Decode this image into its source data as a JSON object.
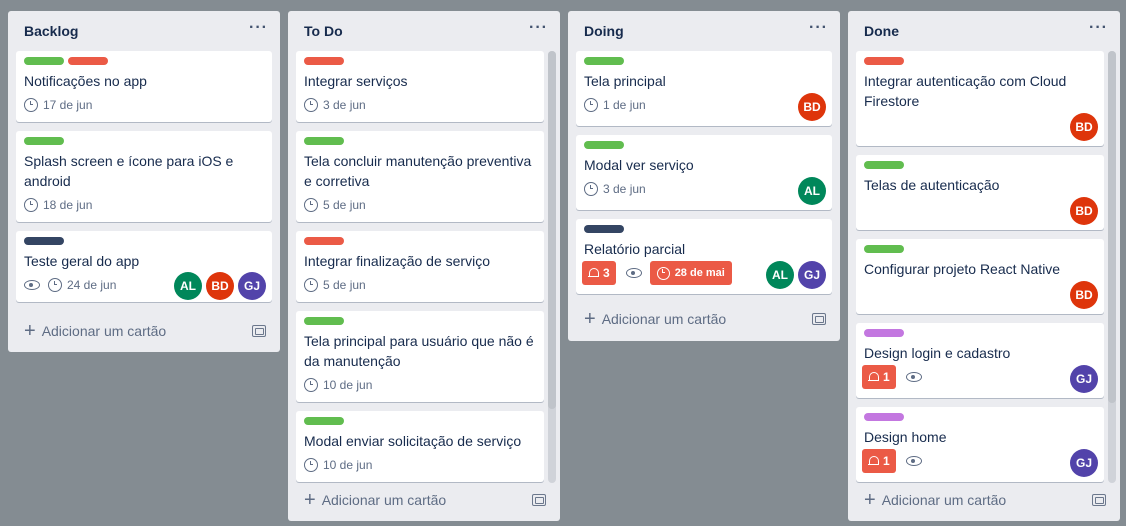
{
  "colors": {
    "green": "#61bd4f",
    "red": "#eb5a46",
    "navy": "#344563",
    "purple": "#c377e0",
    "avatar_al": "#00875a",
    "avatar_bd": "#de350b",
    "avatar_gj": "#5243aa"
  },
  "lists": [
    {
      "title": "Backlog",
      "menu": "···",
      "add_card": "Adicionar um cartão",
      "cards": [
        {
          "title": "Notificações no app",
          "due": "17 de jun"
        },
        {
          "title_lines": [
            "Splash screen e ícone para iOS e",
            "android"
          ],
          "due": "18 de jun"
        },
        {
          "title": "Teste geral do app",
          "due": "24 de jun",
          "members": [
            "AL",
            "BD",
            "GJ"
          ]
        }
      ]
    },
    {
      "title": "To Do",
      "menu": "···",
      "add_card": "Adicionar um cartão",
      "cards": [
        {
          "title": "Integrar serviços",
          "due": "3 de jun"
        },
        {
          "title_lines": [
            "Tela concluir manutenção preventiva",
            "e corretiva"
          ],
          "due": "5 de jun"
        },
        {
          "title": "Integrar finalização de serviço",
          "due": "5 de jun"
        },
        {
          "title_lines": [
            "Tela principal para usuário que não é",
            "da manutenção"
          ],
          "due": "10 de jun"
        },
        {
          "title": "Modal enviar solicitação de serviço",
          "due": "10 de jun"
        }
      ]
    },
    {
      "title": "Doing",
      "menu": "···",
      "add_card": "Adicionar um cartão",
      "cards": [
        {
          "title": "Tela principal",
          "due": "1 de jun",
          "members": [
            "BD"
          ]
        },
        {
          "title": "Modal ver serviço",
          "due": "3 de jun",
          "members": [
            "AL"
          ]
        },
        {
          "title": "Relatório parcial",
          "notifications": "3",
          "due_overdue": "28 de mai",
          "members": [
            "AL",
            "GJ"
          ]
        }
      ]
    },
    {
      "title": "Done",
      "menu": "···",
      "add_card": "Adicionar um cartão",
      "cards": [
        {
          "title_lines": [
            "Integrar autenticação com Cloud",
            "Firestore"
          ],
          "members": [
            "BD"
          ]
        },
        {
          "title": "Telas de autenticação",
          "members": [
            "BD"
          ]
        },
        {
          "title": "Configurar projeto React Native",
          "members": [
            "BD"
          ]
        },
        {
          "title": "Design login e cadastro",
          "notifications": "1",
          "members": [
            "GJ"
          ]
        },
        {
          "title": "Design home",
          "notifications": "1",
          "members": [
            "GJ"
          ]
        }
      ]
    }
  ]
}
